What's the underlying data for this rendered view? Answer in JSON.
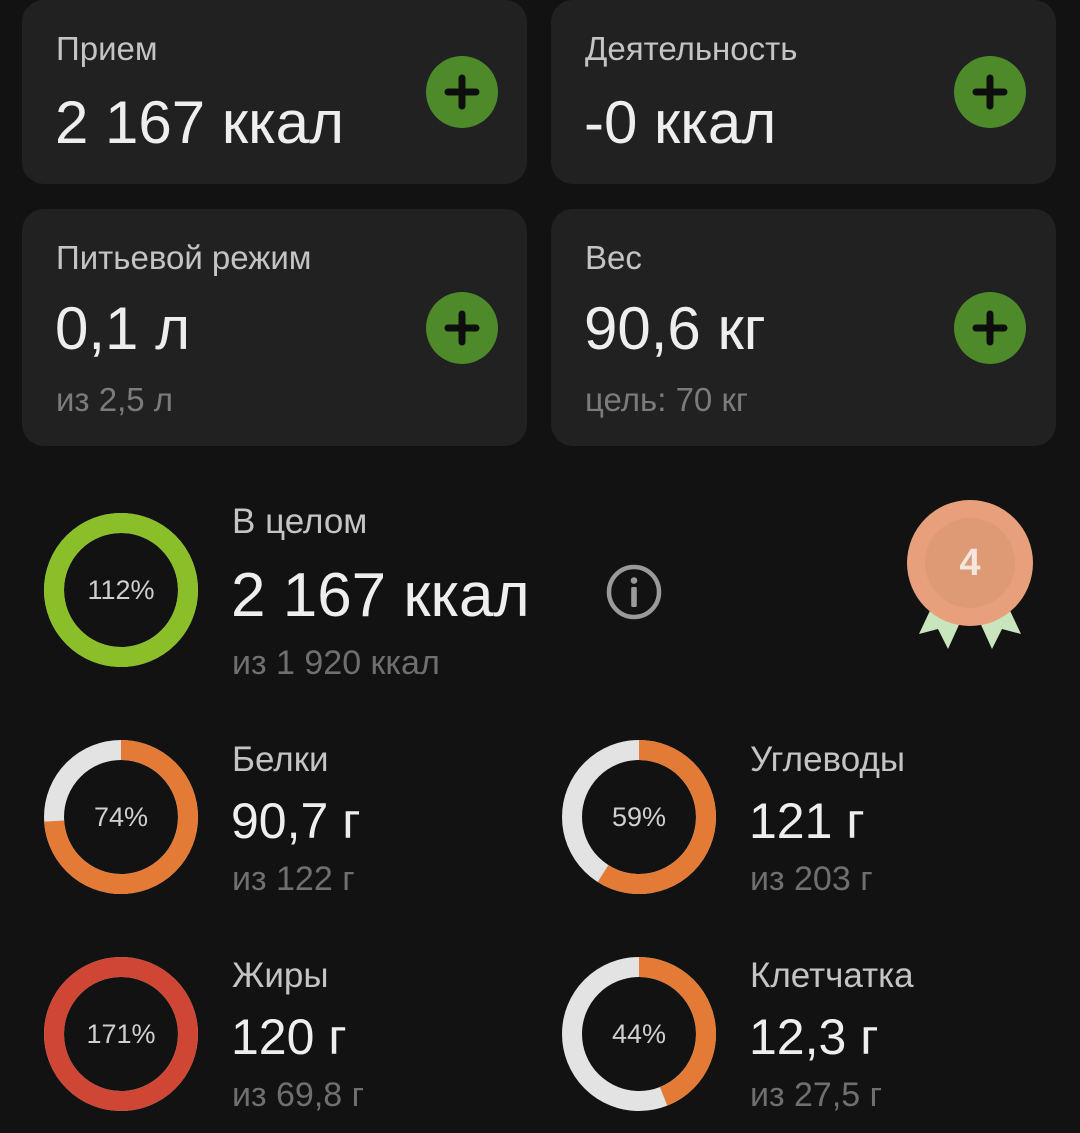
{
  "cards": {
    "intake": {
      "label": "Прием",
      "value": "2 167 ккал"
    },
    "activity": {
      "label": "Деятельность",
      "value": "-0 ккал"
    },
    "water": {
      "label": "Питьевой режим",
      "value": "0,1 л",
      "sub": "из 2,5 л"
    },
    "weight": {
      "label": "Вес",
      "value": "90,6 кг",
      "sub": "цель: 70 кг"
    }
  },
  "summary": {
    "label": "В целом",
    "value": "2 167 ккал",
    "sub": "из 1 920 ккал",
    "percent_text": "112%",
    "progress": 1.12,
    "ring_color": "#8bbf2a",
    "icons": {
      "info": "info-icon",
      "medal": "medal-icon"
    },
    "medal_number": "4"
  },
  "nutrients": {
    "protein": {
      "label": "Белки",
      "value": "90,7 г",
      "sub": "из 122 г",
      "percent_text": "74%",
      "progress": 0.74,
      "color": "#e37b36"
    },
    "carbs": {
      "label": "Углеводы",
      "value": "121 г",
      "sub": "из 203 г",
      "percent_text": "59%",
      "progress": 0.59,
      "color": "#e37b36"
    },
    "fat": {
      "label": "Жиры",
      "value": "120 г",
      "sub": "из 69,8 г",
      "percent_text": "171%",
      "progress": 1.71,
      "color": "#cf4634"
    },
    "fiber": {
      "label": "Клетчатка",
      "value": "12,3 г",
      "sub": "из 27,5 г",
      "percent_text": "44%",
      "progress": 0.44,
      "color": "#e37b36"
    }
  },
  "colors": {
    "background": "#121212",
    "card": "#212121",
    "add_button": "#4e8a2a",
    "ring_track": "#e3e3e3",
    "medal": "#e7a07b",
    "medal_ribbon": "#c9e5be"
  }
}
